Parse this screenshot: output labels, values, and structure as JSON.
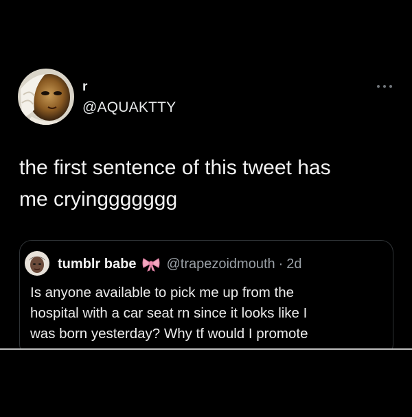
{
  "tweet": {
    "author": {
      "display_name": "r",
      "handle": "@AQUAKTTY",
      "avatar_icon": "profile-photo"
    },
    "menu_icon": "more-options-icon",
    "text_lines": [
      "the first sentence of this tweet has",
      "me cryinggggggg"
    ],
    "quoted": {
      "display_name": "tumblr babe",
      "emoji_icon": "pink-ribbon-bow-icon",
      "handle": "@trapezoidmouth",
      "separator": "·",
      "time": "2d",
      "text_lines": [
        "Is anyone available to pick me up from the",
        "hospital with a car seat rn since it looks like I",
        "was born yesterday? Why tf would I promote"
      ]
    }
  },
  "colors": {
    "background": "#000000",
    "text": "#e7e9ea",
    "secondary_text": "#9aa0a6",
    "border": "#2f3336",
    "bow": "#f4a7c0"
  }
}
